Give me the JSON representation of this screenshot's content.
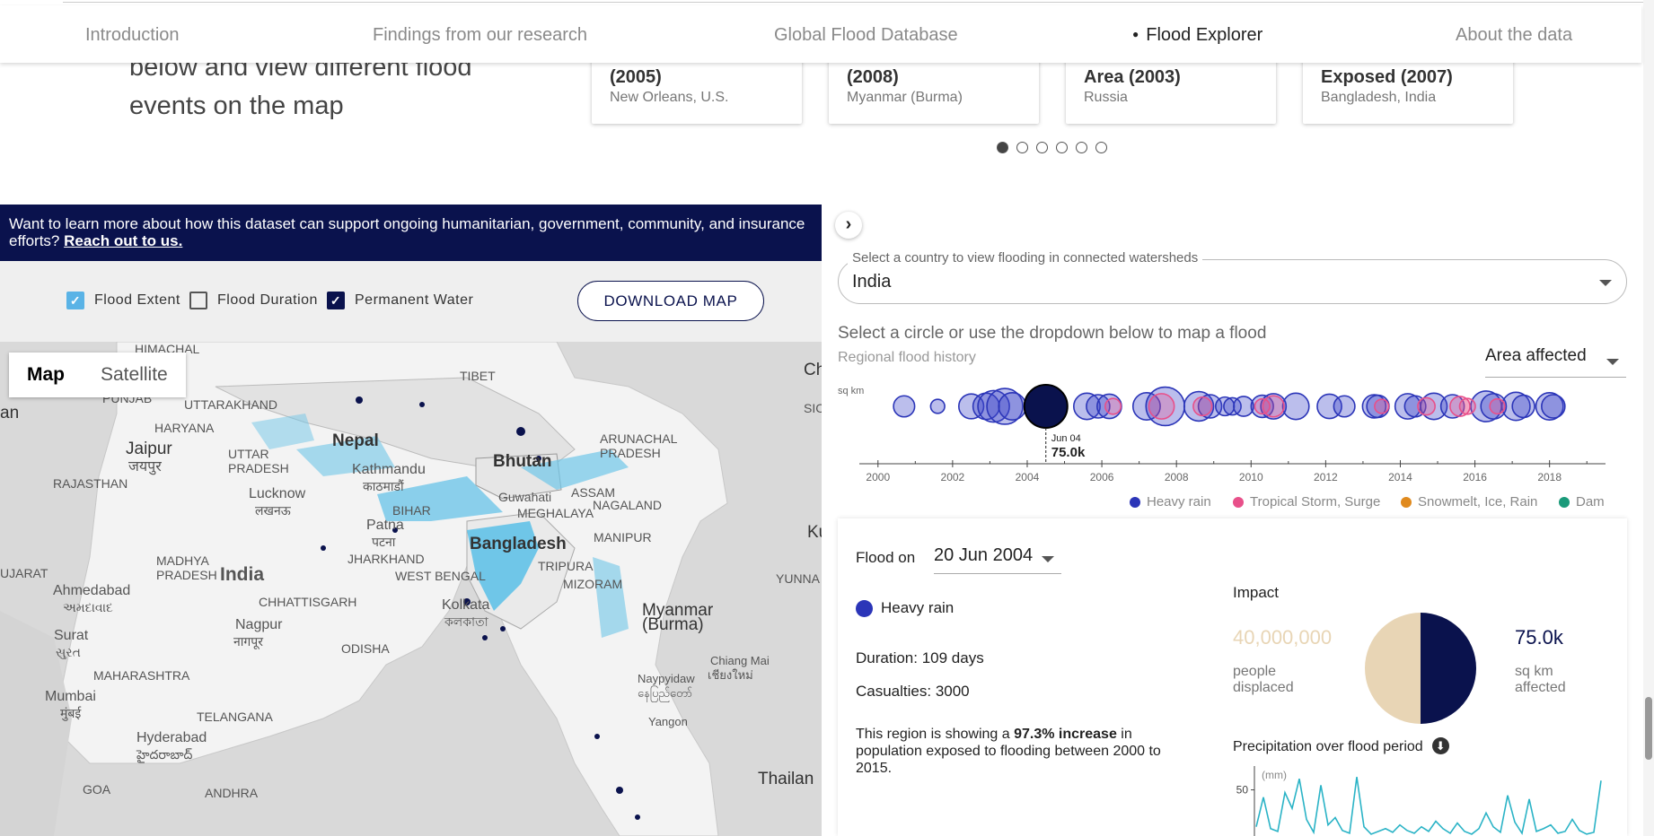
{
  "nav": {
    "items": [
      {
        "label": "Introduction"
      },
      {
        "label": "Findings from our research"
      },
      {
        "label": "Global Flood Database"
      },
      {
        "label": "Flood Explorer"
      },
      {
        "label": "About the data"
      }
    ],
    "active": "Flood Explorer"
  },
  "intro": {
    "text_line1": "below and view different flood",
    "text_line2": "events on the map"
  },
  "cards": [
    {
      "title": "(2005)",
      "location": "New Orleans, U.S."
    },
    {
      "title": "(2008)",
      "location": "Myanmar (Burma)"
    },
    {
      "title": "Area (2003)",
      "location": "Russia"
    },
    {
      "title": "Exposed (2007)",
      "location": "Bangladesh, India"
    }
  ],
  "carousel": {
    "count": 6,
    "active": 1
  },
  "banner": {
    "text": "Want to learn more about how this dataset can support ongoing humanitarian, government, community, and insurance efforts?",
    "link": "Reach out to us."
  },
  "layers": {
    "flood_extent": {
      "label": "Flood Extent",
      "checked": true
    },
    "flood_duration": {
      "label": "Flood Duration",
      "checked": false
    },
    "permanent_water": {
      "label": "Permanent Water",
      "checked": true
    }
  },
  "download_label": "DOWNLOAD MAP",
  "map": {
    "toggle": {
      "map": "Map",
      "satellite": "Satellite",
      "selected": "Map"
    },
    "labels": {
      "himachal": "HIMACHAL",
      "tibet": "TIBET",
      "punjab": "PUNJAB",
      "uttarakhand": "UTTARAKHAND",
      "haryana": "HARYANA",
      "jaipur": "Jaipur",
      "jaipur_hi": "जयपुर",
      "uttar_pradesh": "UTTAR\nPRADESH",
      "nepal": "Nepal",
      "kathmandu": "Kathmandu",
      "kathmandu_ne": "काठमाडौं",
      "bhutan": "Bhutan",
      "arunachal": "ARUNACHAL\nPRADESH",
      "rajasthan": "RAJASTHAN",
      "lucknow": "Lucknow",
      "lucknow_hi": "लखनऊ",
      "bihar": "BIHAR",
      "assam": "ASSAM",
      "guwahati": "Guwahati",
      "meghalaya": "MEGHALAYA",
      "nagaland": "NAGALAND",
      "patna": "Patna",
      "patna_hi": "पटना",
      "manipur": "MANIPUR",
      "bangladesh": "Bangladesh",
      "jharkhand": "JHARKHAND",
      "tripura": "TRIPURA",
      "madhya": "MADHYA\nPRADESH",
      "west_bengal": "WEST BENGAL",
      "mizoram": "MIZORAM",
      "gujarat": "UJARAT",
      "india": "India",
      "ahmedabad": "Ahmedabad",
      "ahmedabad_gu": "અમદાવાદ",
      "chhattisgarh": "CHHATTISGARH",
      "kolkata": "Kolkata",
      "kolkata_bn": "কলকাতা",
      "myanmar": "Myanmar\n(Burma)",
      "nagpur": "Nagpur",
      "nagpur_mr": "नागपूर",
      "surat": "Surat",
      "surat_gu": "સુરત",
      "odisha": "ODISHA",
      "maharashtra": "MAHARASHTRA",
      "chiang_mai": "Chiang Mai",
      "chiang_mai_th": "เชียงใหม่",
      "naypyidaw": "Naypyidaw",
      "naypyidaw_my": "နေပြည်တော်",
      "mumbai": "Mumbai",
      "mumbai_mr": "मुंबई",
      "telangana": "TELANGANA",
      "yangon": "Yangon",
      "hyderabad": "Hyderabad",
      "hyderabad_te": "హైదరాబాద్",
      "goa": "GOA",
      "andhra": "ANDHRA",
      "thailand": "Thailan",
      "ch": "Ch",
      "sic": "SIC",
      "an": "an",
      "ku": "Ku",
      "yunna": "YUNNA"
    }
  },
  "explorer": {
    "country_label": "Select a country to view flooding in connected watersheds",
    "country_value": "India",
    "title": "Select a circle or use the dropdown below to map a flood",
    "subtitle": "Regional flood history",
    "metric": "Area affected",
    "unit": "sq km",
    "tooltip_date": "Jun 04",
    "tooltip_value": "75.0k",
    "legend": [
      {
        "label": "Heavy rain",
        "color": "#2b35b8"
      },
      {
        "label": "Tropical Storm, Surge",
        "color": "#e8508a"
      },
      {
        "label": "Snowmelt, Ice, Rain",
        "color": "#e08a1e"
      },
      {
        "label": "Dam",
        "color": "#1a9a7a"
      }
    ]
  },
  "chart_data": [
    {
      "type": "scatter",
      "title": "Regional flood history",
      "ylabel": "sq km",
      "xlim": [
        1999.5,
        2019.5
      ],
      "xticks": [
        "2000",
        "2002",
        "2004",
        "2006",
        "2008",
        "2010",
        "2012",
        "2014",
        "2016",
        "2018"
      ],
      "series": [
        {
          "name": "Heavy rain",
          "color": "#2b35b8",
          "x": [
            2000.7,
            2001.6,
            2002.5,
            2002.9,
            2003.1,
            2003.4,
            2003.6,
            2004.5,
            2005.6,
            2005.9,
            2006.2,
            2007.2,
            2007.7,
            2008.6,
            2008.9,
            2009.3,
            2009.5,
            2009.8,
            2010.3,
            2010.6,
            2011.2,
            2012.1,
            2012.5,
            2013.3,
            2013.4,
            2014.2,
            2014.4,
            2014.9,
            2015.4,
            2016.3,
            2016.5,
            2017.1,
            2017.3,
            2018.0,
            2018.1
          ],
          "y": [
            18000,
            8000,
            25000,
            28000,
            40000,
            52000,
            30000,
            75000,
            28000,
            22000,
            24000,
            30000,
            60000,
            35000,
            22000,
            14000,
            12000,
            16000,
            20000,
            26000,
            28000,
            24000,
            18000,
            22000,
            20000,
            26000,
            18000,
            28000,
            22000,
            38000,
            26000,
            32000,
            20000,
            30000,
            22000
          ]
        },
        {
          "name": "Tropical Storm, Surge",
          "color": "#e8508a",
          "x": [
            2006.3,
            2007.6,
            2008.7,
            2010.3,
            2010.6,
            2013.5,
            2014.7,
            2015.6,
            2015.8,
            2016.6
          ],
          "y": [
            10000,
            26000,
            14000,
            9000,
            18000,
            8000,
            12000,
            16000,
            10000,
            9000
          ]
        }
      ],
      "highlight": {
        "date": "Jun 04",
        "value": "75.0k"
      }
    },
    {
      "type": "pie",
      "categories": [
        "people displaced",
        "sq km affected"
      ],
      "values": [
        50,
        50
      ],
      "colors": [
        "#e8d5b5",
        "#0a124d"
      ]
    },
    {
      "type": "line",
      "title": "Precipitation over flood period",
      "ylabel": "(mm)",
      "yticks": [
        "50"
      ],
      "color": "#2ab3c6",
      "values": [
        10,
        42,
        8,
        5,
        47,
        30,
        62,
        18,
        4,
        55,
        12,
        20,
        6,
        3,
        64,
        10,
        2,
        5,
        8,
        4,
        12,
        6,
        3,
        10,
        5,
        16,
        8,
        3,
        14,
        5,
        2,
        8,
        25,
        10,
        4,
        44,
        15,
        3,
        40,
        5,
        8,
        12,
        3,
        5,
        18,
        6,
        2,
        4,
        60
      ]
    }
  ],
  "detail": {
    "flood_on_label": "Flood on",
    "date": "20 Jun 2004",
    "cause": "Heavy rain",
    "cause_color": "#2b35b8",
    "duration": "Duration: 109 days",
    "casualties": "Casualties: 3000",
    "region_text_pre": "This region is showing a ",
    "region_text_bold": "97.3% increase",
    "region_text_post": " in population exposed to flooding between 2000 to 2015.",
    "impact_label": "Impact",
    "people_value": "40,000,000",
    "people_label": "people displaced",
    "area_value": "75.0k",
    "area_label": "sq km affected",
    "precip_title": "Precipitation over flood period",
    "precip_unit": "(mm)",
    "precip_tick": "50"
  }
}
